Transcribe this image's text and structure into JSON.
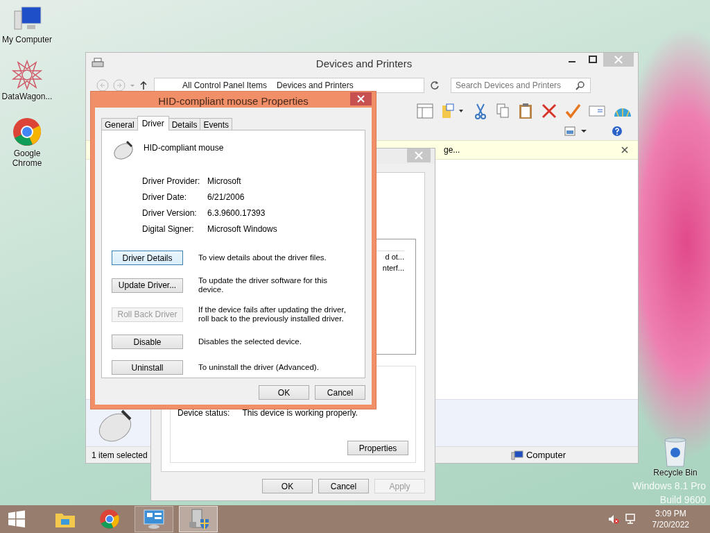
{
  "desktop_icons": [
    {
      "label": "My Computer",
      "kind": "computer"
    },
    {
      "label": "DataWagon...",
      "kind": "star"
    },
    {
      "label": "Google Chrome",
      "kind": "chrome"
    }
  ],
  "recycle_bin": {
    "label": "Recycle Bin"
  },
  "watermark": [
    "Windows 8.1 Pro",
    "Build 9600"
  ],
  "explorer": {
    "title": "Devices and Printers",
    "address": [
      "All Control Panel Items",
      "Devices and Printers"
    ],
    "search": {
      "placeholder": "Search Devices and Printers"
    },
    "info_bar": "ge...",
    "status_bar": {
      "selection": "1 item selected",
      "location": "Computer"
    }
  },
  "device_dialog": {
    "list_cells": [
      "d ot...",
      "nterf..."
    ],
    "status_label": "Device status:",
    "status": "This device is working properly.",
    "properties_button": "Properties",
    "buttons": [
      {
        "label": "OK",
        "disabled": false
      },
      {
        "label": "Cancel",
        "disabled": false
      },
      {
        "label": "Apply",
        "disabled": true
      }
    ]
  },
  "properties": {
    "title": "HID-compliant mouse Properties",
    "tabs": [
      {
        "label": "General",
        "selected": false
      },
      {
        "label": "Driver",
        "selected": true
      },
      {
        "label": "Details",
        "selected": false
      },
      {
        "label": "Events",
        "selected": false
      }
    ],
    "device_name": "HID-compliant mouse",
    "info": [
      {
        "label": "Driver Provider:",
        "value": "Microsoft"
      },
      {
        "label": "Driver Date:",
        "value": "6/21/2006"
      },
      {
        "label": "Driver Version:",
        "value": "6.3.9600.17393"
      },
      {
        "label": "Digital Signer:",
        "value": "Microsoft Windows"
      }
    ],
    "actions": [
      {
        "button": "Driver Details",
        "description": "To view details about the driver files.",
        "disabled": false,
        "focused": true
      },
      {
        "button": "Update Driver...",
        "description": "To update the driver software for this device.",
        "disabled": false,
        "focused": false
      },
      {
        "button": "Roll Back Driver",
        "description": "If the device fails after updating the driver, roll back to the previously installed driver.",
        "disabled": true,
        "focused": false
      },
      {
        "button": "Disable",
        "description": "Disables the selected device.",
        "disabled": false,
        "focused": false
      },
      {
        "button": "Uninstall",
        "description": "To uninstall the driver (Advanced).",
        "disabled": false,
        "focused": false
      }
    ],
    "buttons": [
      "OK",
      "Cancel"
    ]
  },
  "taskbar": {
    "apps": [
      {
        "kind": "explorer",
        "running": false,
        "selected": false
      },
      {
        "kind": "chrome",
        "running": false,
        "selected": false
      },
      {
        "kind": "control-panel",
        "running": true,
        "selected": false
      },
      {
        "kind": "device-manager",
        "running": true,
        "selected": true
      }
    ],
    "time": "3:09 PM",
    "date": "7/20/2022"
  }
}
